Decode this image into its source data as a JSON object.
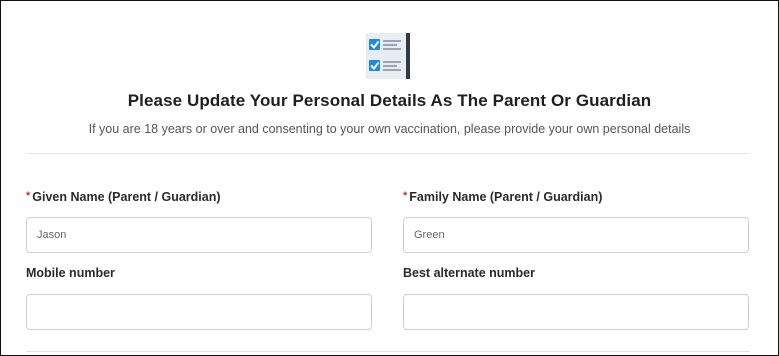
{
  "header": {
    "icon": "checklist-icon",
    "title": "Please Update Your Personal Details As The Parent Or Guardian",
    "subtitle": "If you are 18 years or over and consenting to your own vaccination, please provide your own personal details"
  },
  "form": {
    "given_name": {
      "required_mark": "*",
      "label": "Given Name (Parent / Guardian)",
      "value": "Jason"
    },
    "family_name": {
      "required_mark": "*",
      "label": "Family Name (Parent / Guardian)",
      "value": "Green"
    },
    "mobile": {
      "label": "Mobile number",
      "value": ""
    },
    "alternate": {
      "label": "Best alternate number",
      "value": ""
    }
  },
  "colors": {
    "checkbox": "#1e88e5",
    "required": "#c0392b",
    "border": "#cfcfcf"
  }
}
